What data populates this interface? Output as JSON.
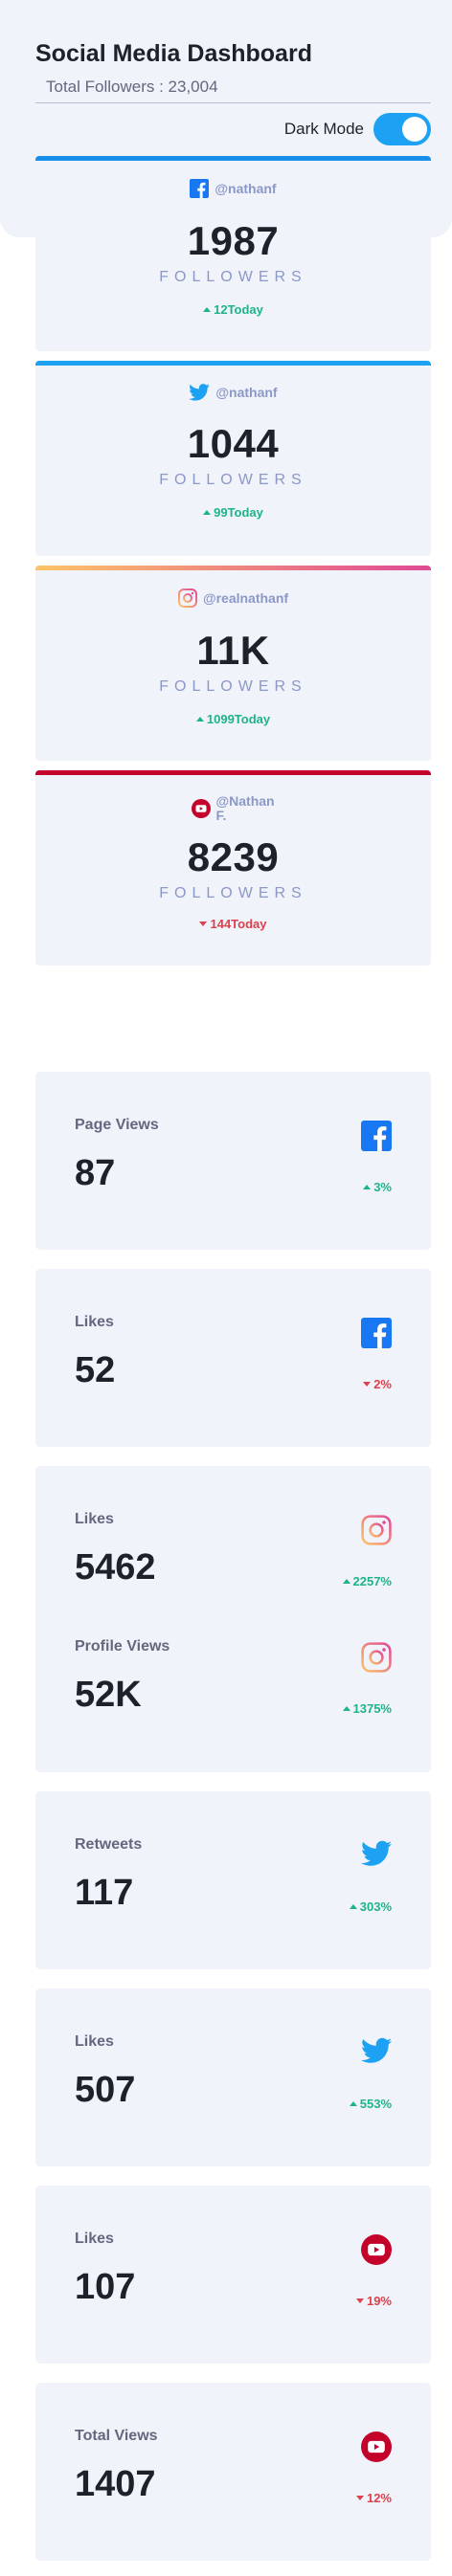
{
  "header": {
    "title": "Social Media Dashboard",
    "total_followers": "Total Followers : 23,004",
    "dark_mode_label": "Dark Mode"
  },
  "colors": {
    "facebook": "#1877f2",
    "twitter": "#1da1f2",
    "youtube": "#c4032b",
    "up": "#1db489",
    "down": "#dc414c"
  },
  "follower_cards": [
    {
      "platform": "facebook",
      "icon": "facebook-icon",
      "handle": "@nathanf",
      "count": "1987",
      "label": "FOLLOWERS",
      "today": "12Today",
      "trend": "up"
    },
    {
      "platform": "twitter",
      "icon": "twitter-icon",
      "handle": "@nathanf",
      "count": "1044",
      "label": "FOLLOWERS",
      "today": "99Today",
      "trend": "up"
    },
    {
      "platform": "instagram",
      "icon": "instagram-icon",
      "handle": "@realnathanf",
      "count": "11K",
      "label": "FOLLOWERS",
      "today": "1099Today",
      "trend": "up"
    },
    {
      "platform": "youtube",
      "icon": "youtube-icon",
      "handle": "@Nathan F.",
      "count": "8239",
      "label": "FOLLOWERS",
      "today": "144Today",
      "trend": "down"
    }
  ],
  "overview": [
    {
      "title": "Page Views",
      "value": "87",
      "percent": "3%",
      "trend": "up",
      "icon": "facebook-icon"
    },
    {
      "title": "Likes",
      "value": "52",
      "percent": "2%",
      "trend": "down",
      "icon": "facebook-icon"
    },
    {
      "title": "Likes",
      "value": "5462",
      "percent": "2257%",
      "trend": "up",
      "icon": "instagram-icon"
    },
    {
      "title": "Profile Views",
      "value": "52K",
      "percent": "1375%",
      "trend": "up",
      "icon": "instagram-icon"
    },
    {
      "title": "Retweets",
      "value": "117",
      "percent": "303%",
      "trend": "up",
      "icon": "twitter-icon"
    },
    {
      "title": "Likes",
      "value": "507",
      "percent": "553%",
      "trend": "up",
      "icon": "twitter-icon"
    },
    {
      "title": "Likes",
      "value": "107",
      "percent": "19%",
      "trend": "down",
      "icon": "youtube-icon"
    },
    {
      "title": "Total Views",
      "value": "1407",
      "percent": "12%",
      "trend": "down",
      "icon": "youtube-icon"
    }
  ]
}
